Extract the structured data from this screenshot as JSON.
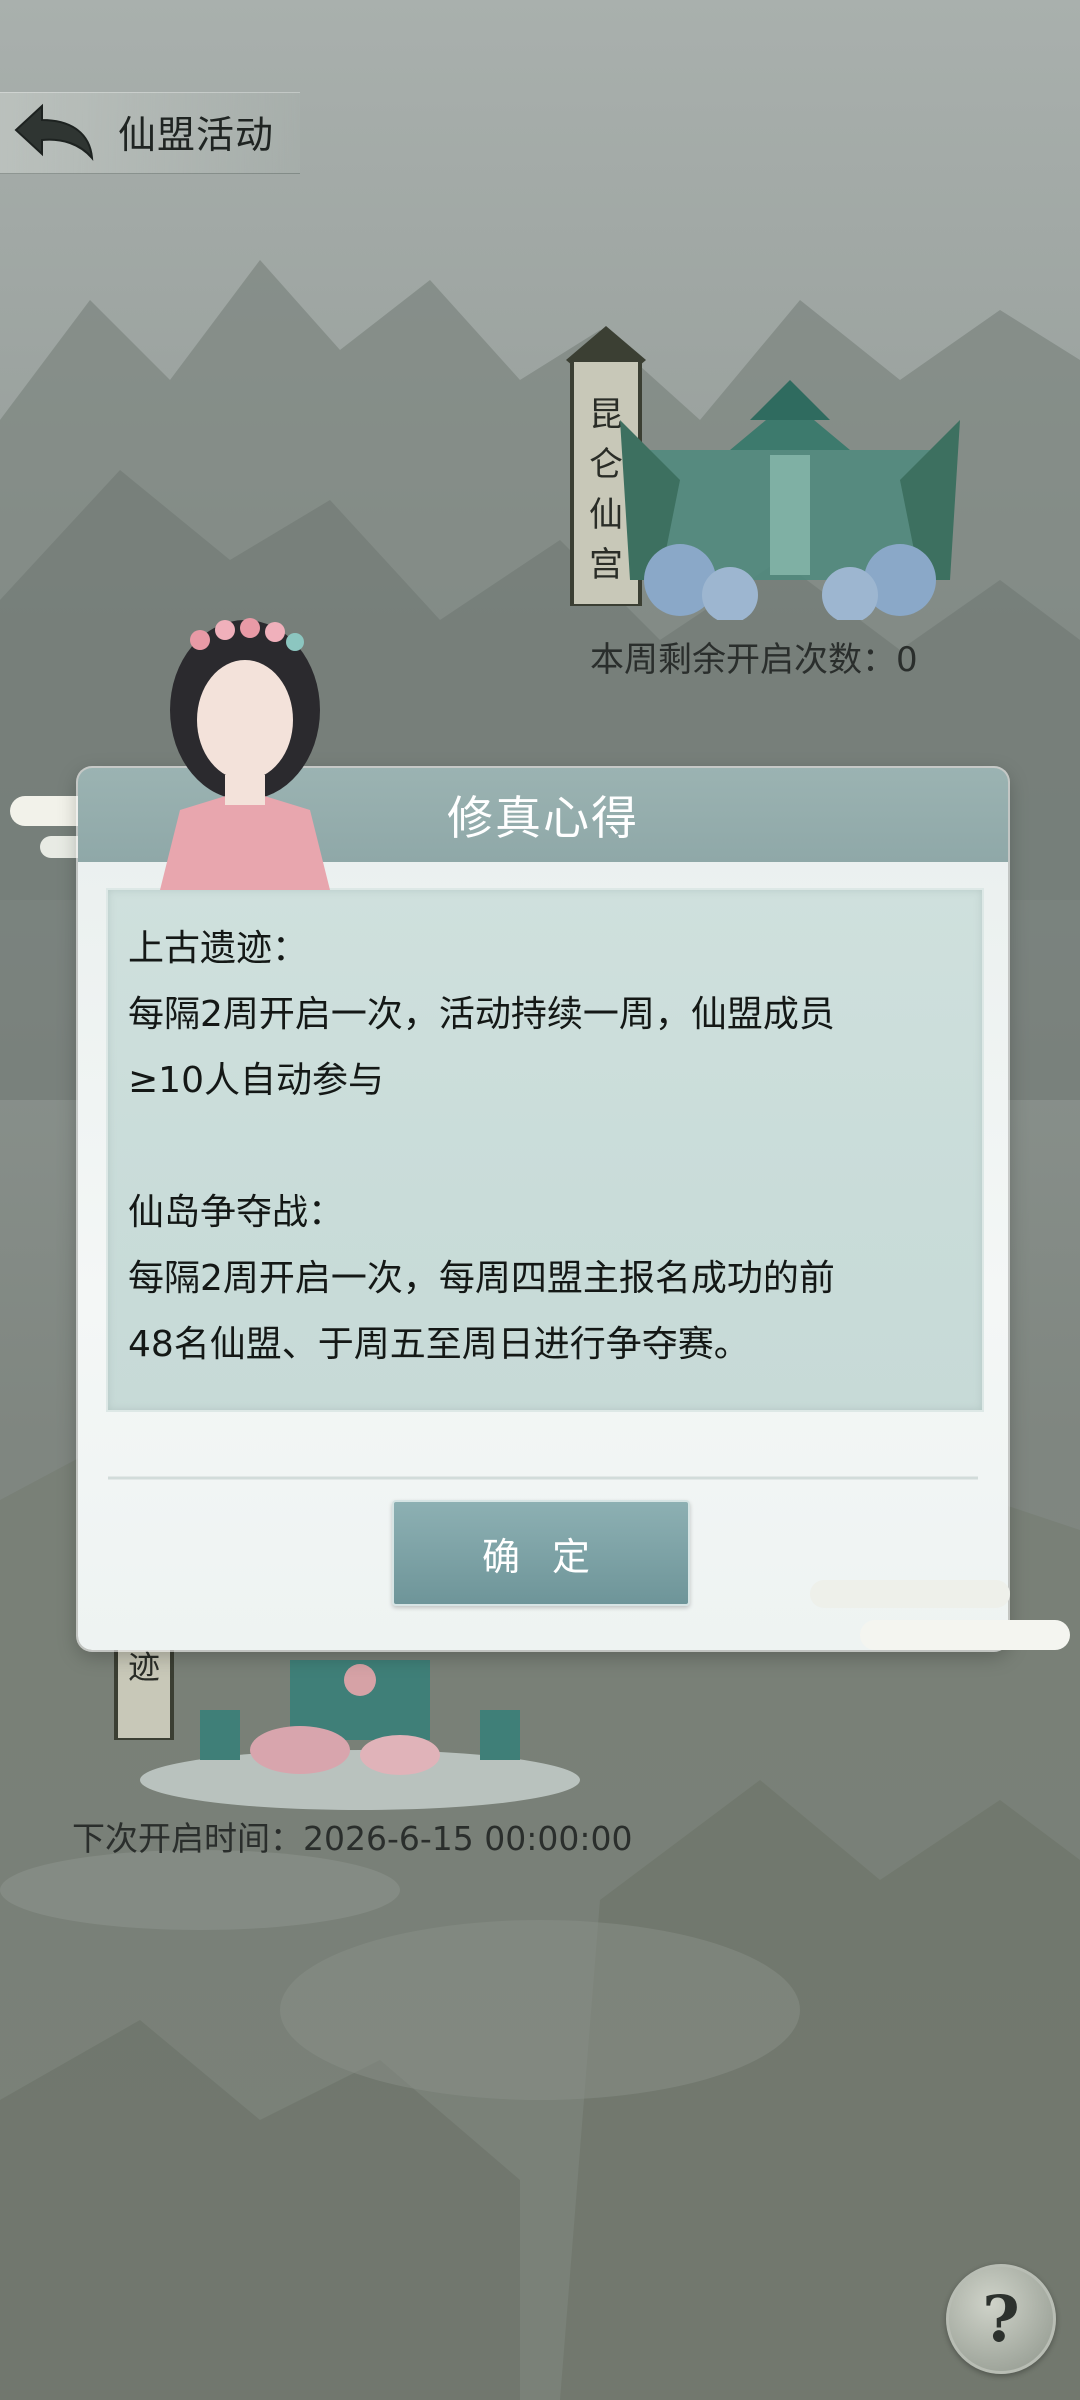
{
  "header": {
    "title": "仙盟活动"
  },
  "map": {
    "banner_top": "昆仑仙宫",
    "remaining_label": "本周剩余开启次数：0",
    "banner_bottom_fragment": "迹",
    "next_open_label": "下次开启时间：2026-6-15 00:00:00"
  },
  "dialog": {
    "title": "修真心得",
    "sections": [
      {
        "heading": "上古遗迹：",
        "body_line1": "每隔2周开启一次，活动持续一周，仙盟成员",
        "body_line2": "≥10人自动参与"
      },
      {
        "heading": "仙岛争夺战：",
        "body_line1": "每隔2周开启一次，每周四盟主报名成功的前",
        "body_line2": "48名仙盟、于周五至周日进行争夺赛。"
      }
    ],
    "confirm_label": "确 定"
  },
  "help": {
    "label": "?"
  },
  "colors": {
    "accent": "#8fa8a8",
    "button": "#6e9599",
    "content_bg": "#cfe0dd"
  }
}
